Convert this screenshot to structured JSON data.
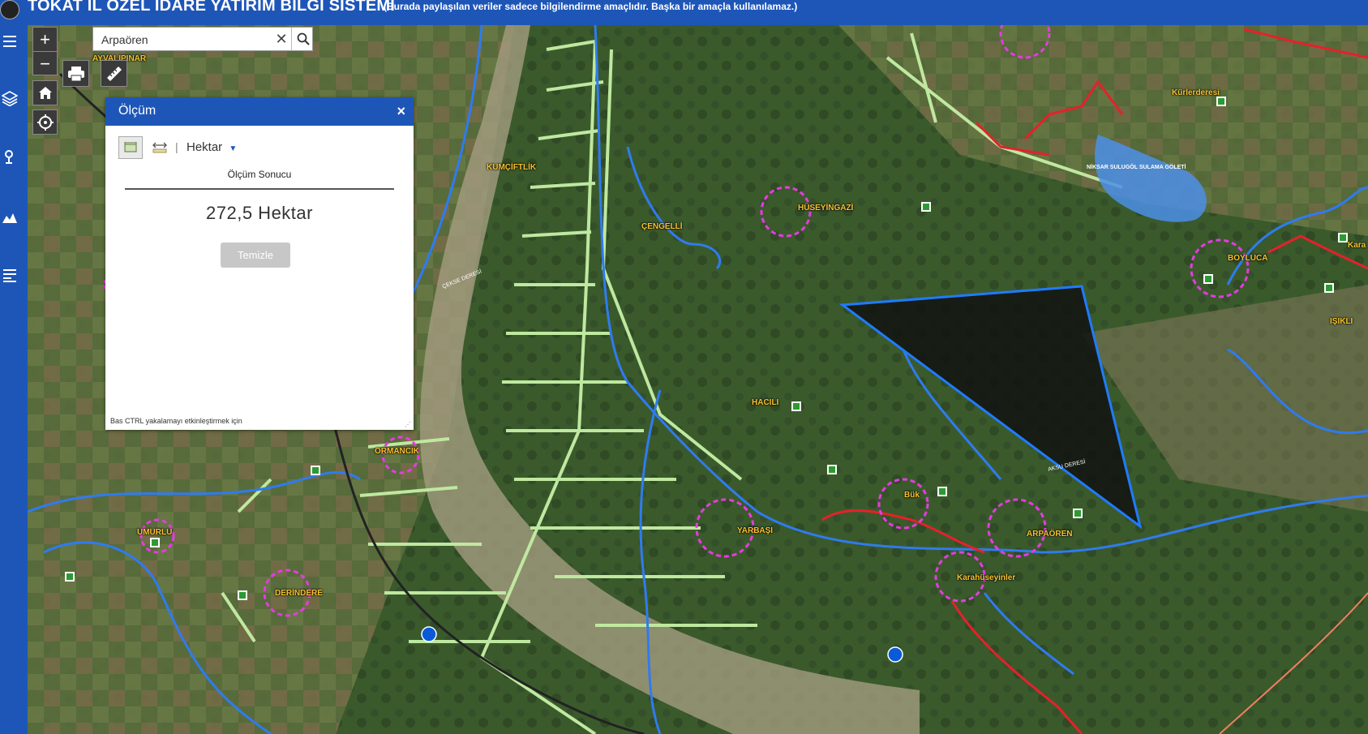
{
  "app": {
    "title": "TOKAT İL ÖZEL İDARE YATIRIM BİLGİ SİSTEMİ",
    "disclaimer": "(Burada paylaşılan veriler sadece bilgilendirme amaçlıdır. Başka bir amaçla kullanılamaz.)"
  },
  "sidebar": {
    "items": [
      {
        "icon": "menu-icon"
      },
      {
        "icon": "layers-icon"
      },
      {
        "icon": "location-pin-icon"
      },
      {
        "icon": "elevation-chart-icon"
      },
      {
        "icon": "list-icon"
      }
    ]
  },
  "map_controls": {
    "zoom_in": "+",
    "zoom_out": "−",
    "home_icon": "home-icon",
    "locate_icon": "locate-icon",
    "print_icon": "print-icon",
    "measure_icon": "ruler-icon"
  },
  "search": {
    "value": "Arpaören",
    "clear": "✕"
  },
  "measure_panel": {
    "title": "Ölçüm",
    "close": "×",
    "unit": "Hektar",
    "result_label": "Ölçüm Sonucu",
    "result_value": "272,5 Hektar",
    "clear_label": "Temizle",
    "hint": "Bas CTRL yakalamayı etkinleştirmek için"
  },
  "places": [
    {
      "name": "KUMÇİFTLİK"
    },
    {
      "name": "ÇENGELLİ"
    },
    {
      "name": "HÜSEYİNGAZİ"
    },
    {
      "name": "HACILI"
    },
    {
      "name": "ORMANCIK"
    },
    {
      "name": "UMURLU"
    },
    {
      "name": "DERİNDERE"
    },
    {
      "name": "YARBAŞI"
    },
    {
      "name": "Bük"
    },
    {
      "name": "ARPAÖREN"
    },
    {
      "name": "Karahüseyinler"
    },
    {
      "name": "BOYLUCA"
    },
    {
      "name": "IŞIKLI"
    },
    {
      "name": "Kürlerderesi"
    },
    {
      "name": "Kara"
    },
    {
      "name": "AYVALIPINAR"
    }
  ],
  "water_labels": {
    "pond": "NİKSAR SULUGÖL SULAMA GÖLETİ",
    "stream1": "ÇEKSE DERESİ",
    "stream2": "AKSU DERESİ"
  },
  "colors": {
    "header": "#1e56b8",
    "measure_polygon": "#121212",
    "polygon_stroke": "#1f7bff",
    "river": "#2f7bef",
    "road": "#e5212b",
    "village": "#e43ce0",
    "parcel": "#bfe8a0"
  }
}
